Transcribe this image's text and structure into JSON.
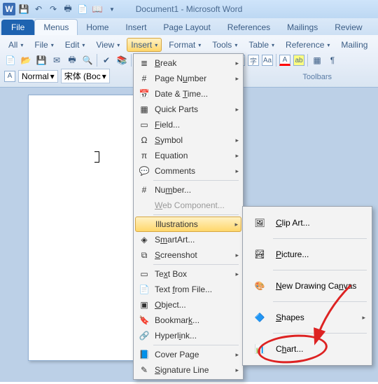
{
  "title": "Document1 - Microsoft Word",
  "tabs": {
    "file": "File",
    "menus": "Menus",
    "home": "Home",
    "insert": "Insert",
    "pagelayout": "Page Layout",
    "references": "References",
    "mailings": "Mailings",
    "review": "Review"
  },
  "mr1": {
    "all": "All",
    "file": "File",
    "edit": "Edit",
    "view": "View",
    "insert": "Insert",
    "format": "Format",
    "tools": "Tools",
    "table": "Table",
    "reference": "Reference",
    "mailing": "Mailing"
  },
  "mr3": {
    "normal": "Normal",
    "font": "宋体 (Boc"
  },
  "ribbon_label": "Toolbars",
  "insert_menu": {
    "break": "Break",
    "page_number": "Page Number",
    "date_time": "Date & Time...",
    "quick_parts": "Quick Parts",
    "field": "Field...",
    "symbol": "Symbol",
    "equation": "Equation",
    "comments": "Comments",
    "number": "Number...",
    "web_component": "Web Component...",
    "illustrations": "Illustrations",
    "smartart": "SmartArt...",
    "screenshot": "Screenshot",
    "text_box": "Text Box",
    "text_from_file": "Text from File...",
    "object": "Object...",
    "bookmark": "Bookmark...",
    "hyperlink": "Hyperlink...",
    "cover_page": "Cover Page",
    "signature_line": "Signature Line"
  },
  "illus_menu": {
    "clip_art": "Clip Art...",
    "picture": "Picture...",
    "drawing_canvas": "New Drawing Canvas",
    "shapes": "Shapes",
    "chart": "Chart..."
  }
}
